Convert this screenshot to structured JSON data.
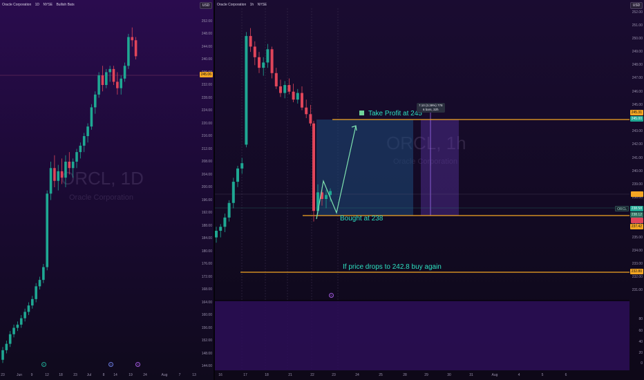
{
  "colors": {
    "up": "#1fa893",
    "down": "#e0455a",
    "orange": "#f5a623",
    "accent_text": "#2de0c0",
    "rect_blue": "#1e4a7a",
    "measure_purple": "#6a3bbf"
  },
  "left_chart": {
    "header": [
      "Oracle Corporation",
      "1D",
      "NYSE",
      "Bullish Bats"
    ],
    "currency": "USD",
    "watermark_title": "ORCL, 1D",
    "watermark_sub": "Oracle Corporation",
    "price_ticks": [
      "256.00",
      "252.00",
      "248.00",
      "244.00",
      "240.00",
      "236.00",
      "232.00",
      "228.00",
      "224.00",
      "220.00",
      "216.00",
      "212.00",
      "208.00",
      "204.00",
      "200.00",
      "196.00",
      "192.00",
      "188.00",
      "184.00",
      "180.00",
      "176.00",
      "172.00",
      "168.00",
      "164.00",
      "160.00",
      "156.00",
      "152.00",
      "148.00",
      "144.00"
    ],
    "time_ticks": [
      "23",
      "Jun",
      "9",
      "12",
      "18",
      "23",
      "Jul",
      "8",
      "14",
      "19",
      "24",
      "Aug",
      "7",
      "13"
    ],
    "current_price_tag": "245.06",
    "event_icons": [
      "earnings-icon",
      "dividend-icon",
      "split-icon"
    ],
    "candles": [
      {
        "o": 146,
        "h": 150,
        "l": 145,
        "c": 149
      },
      {
        "o": 149,
        "h": 152,
        "l": 148,
        "c": 151
      },
      {
        "o": 151,
        "h": 155,
        "l": 150,
        "c": 154
      },
      {
        "o": 154,
        "h": 157,
        "l": 153,
        "c": 156
      },
      {
        "o": 156,
        "h": 158,
        "l": 155,
        "c": 157
      },
      {
        "o": 157,
        "h": 160,
        "l": 156,
        "c": 159
      },
      {
        "o": 159,
        "h": 162,
        "l": 158,
        "c": 161
      },
      {
        "o": 161,
        "h": 164,
        "l": 160,
        "c": 163
      },
      {
        "o": 163,
        "h": 166,
        "l": 162,
        "c": 165
      },
      {
        "o": 165,
        "h": 170,
        "l": 164,
        "c": 169
      },
      {
        "o": 169,
        "h": 172,
        "l": 168,
        "c": 171
      },
      {
        "o": 171,
        "h": 176,
        "l": 170,
        "c": 175
      },
      {
        "o": 175,
        "h": 199,
        "l": 174,
        "c": 198
      },
      {
        "o": 198,
        "h": 208,
        "l": 196,
        "c": 206
      },
      {
        "o": 206,
        "h": 210,
        "l": 200,
        "c": 202
      },
      {
        "o": 202,
        "h": 207,
        "l": 199,
        "c": 205
      },
      {
        "o": 205,
        "h": 209,
        "l": 201,
        "c": 203
      },
      {
        "o": 203,
        "h": 210,
        "l": 200,
        "c": 208
      },
      {
        "o": 208,
        "h": 211,
        "l": 204,
        "c": 206
      },
      {
        "o": 206,
        "h": 209,
        "l": 203,
        "c": 208
      },
      {
        "o": 208,
        "h": 212,
        "l": 206,
        "c": 211
      },
      {
        "o": 211,
        "h": 214,
        "l": 209,
        "c": 213
      },
      {
        "o": 213,
        "h": 217,
        "l": 211,
        "c": 216
      },
      {
        "o": 216,
        "h": 220,
        "l": 214,
        "c": 219
      },
      {
        "o": 219,
        "h": 226,
        "l": 218,
        "c": 225
      },
      {
        "o": 225,
        "h": 230,
        "l": 223,
        "c": 229
      },
      {
        "o": 229,
        "h": 236,
        "l": 228,
        "c": 235
      },
      {
        "o": 235,
        "h": 238,
        "l": 230,
        "c": 232
      },
      {
        "o": 232,
        "h": 237,
        "l": 231,
        "c": 236
      },
      {
        "o": 236,
        "h": 238,
        "l": 233,
        "c": 237
      },
      {
        "o": 237,
        "h": 238,
        "l": 232,
        "c": 233
      },
      {
        "o": 233,
        "h": 236,
        "l": 229,
        "c": 231
      },
      {
        "o": 231,
        "h": 235,
        "l": 229,
        "c": 234
      },
      {
        "o": 234,
        "h": 239,
        "l": 233,
        "c": 238
      },
      {
        "o": 238,
        "h": 248,
        "l": 237,
        "c": 247
      },
      {
        "o": 247,
        "h": 250,
        "l": 244,
        "c": 246
      },
      {
        "o": 246,
        "h": 247,
        "l": 240,
        "c": 241
      }
    ]
  },
  "right_chart": {
    "header": [
      "Oracle Corporation",
      "1h",
      "NYSE"
    ],
    "currency": "USD",
    "watermark_title": "ORCL, 1h",
    "watermark_sub": "Oracle Corporation",
    "price_ticks": [
      "252.00",
      "251.00",
      "250.00",
      "249.00",
      "248.00",
      "247.00",
      "246.00",
      "245.00",
      "244.00",
      "243.00",
      "242.00",
      "241.00",
      "240.00",
      "239.00",
      "238.00",
      "237.00",
      "236.00",
      "235.00",
      "234.00",
      "233.00",
      "232.00",
      "231.00"
    ],
    "osc_ticks": [
      "80",
      "60",
      "40",
      "20",
      "0"
    ],
    "time_ticks": [
      "16",
      "17",
      "18",
      "21",
      "22",
      "23",
      "24",
      "25",
      "28",
      "29",
      "30",
      "31",
      "Aug",
      "4",
      "5",
      "6"
    ],
    "annotations": {
      "take_profit": "Take Profit at 245",
      "bought": "Bought at 238",
      "buy_again": "If price drops to 242.8 buy again"
    },
    "measure_box": {
      "line1": "7.10 (3.39%) 778",
      "line2": "6 bars, 32h"
    },
    "price_tags": {
      "top": "245.31",
      "second": "245.00",
      "ticker_label": "ORCL",
      "last": "238.58",
      "small1": "238.12",
      "small2": "237.42",
      "bottom": "232.80"
    },
    "candles": [
      {
        "o": 235.0,
        "h": 235.8,
        "l": 234.6,
        "c": 235.5
      },
      {
        "o": 235.5,
        "h": 236.0,
        "l": 235.0,
        "c": 235.8
      },
      {
        "o": 235.8,
        "h": 236.8,
        "l": 235.4,
        "c": 236.5
      },
      {
        "o": 236.5,
        "h": 237.8,
        "l": 236.2,
        "c": 237.6
      },
      {
        "o": 237.6,
        "h": 239.5,
        "l": 237.2,
        "c": 239.2
      },
      {
        "o": 239.2,
        "h": 240.4,
        "l": 238.8,
        "c": 240.2
      },
      {
        "o": 240.2,
        "h": 241.0,
        "l": 239.8,
        "c": 240.6
      },
      {
        "o": 242.0,
        "h": 250.5,
        "l": 241.8,
        "c": 250.2
      },
      {
        "o": 250.2,
        "h": 250.8,
        "l": 249.0,
        "c": 249.4
      },
      {
        "o": 249.4,
        "h": 249.8,
        "l": 248.0,
        "c": 248.6
      },
      {
        "o": 248.6,
        "h": 249.0,
        "l": 247.4,
        "c": 247.8
      },
      {
        "o": 247.8,
        "h": 248.6,
        "l": 247.2,
        "c": 248.2
      },
      {
        "o": 248.2,
        "h": 249.6,
        "l": 247.8,
        "c": 249.2
      },
      {
        "o": 249.2,
        "h": 249.4,
        "l": 247.0,
        "c": 247.4
      },
      {
        "o": 247.4,
        "h": 247.8,
        "l": 246.2,
        "c": 246.4
      },
      {
        "o": 246.4,
        "h": 246.9,
        "l": 245.6,
        "c": 245.9
      },
      {
        "o": 245.9,
        "h": 246.8,
        "l": 245.5,
        "c": 246.5
      },
      {
        "o": 246.5,
        "h": 247.0,
        "l": 245.8,
        "c": 246.0
      },
      {
        "o": 246.0,
        "h": 246.6,
        "l": 245.2,
        "c": 245.4
      },
      {
        "o": 245.4,
        "h": 246.2,
        "l": 245.1,
        "c": 245.9
      },
      {
        "o": 245.9,
        "h": 246.4,
        "l": 244.6,
        "c": 244.8
      },
      {
        "o": 244.8,
        "h": 245.4,
        "l": 244.0,
        "c": 244.3
      },
      {
        "o": 244.3,
        "h": 245.0,
        "l": 243.4,
        "c": 243.6
      },
      {
        "o": 243.6,
        "h": 243.8,
        "l": 236.2,
        "c": 237.0
      },
      {
        "o": 237.0,
        "h": 239.0,
        "l": 236.8,
        "c": 238.4
      },
      {
        "o": 238.4,
        "h": 238.8,
        "l": 237.4,
        "c": 237.9
      },
      {
        "o": 237.9,
        "h": 238.6,
        "l": 237.2,
        "c": 238.2
      },
      {
        "o": 238.2,
        "h": 238.7,
        "l": 237.7,
        "c": 238.5
      }
    ]
  }
}
